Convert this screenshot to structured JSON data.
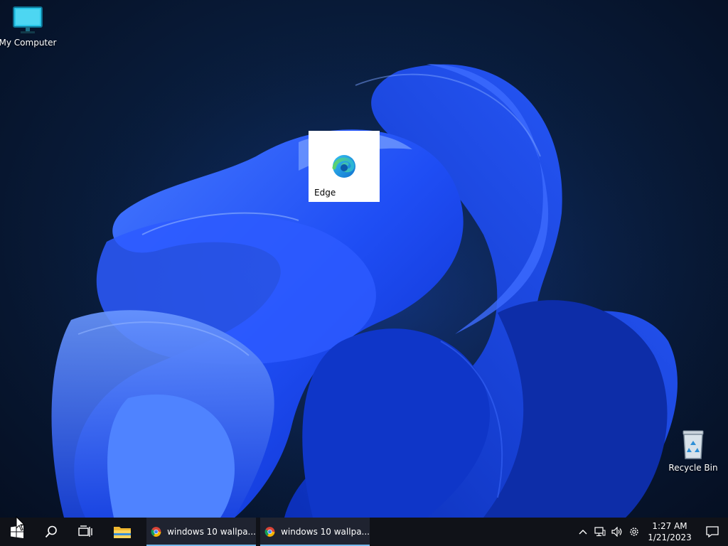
{
  "desktop": {
    "icons": {
      "my_computer": {
        "label": "My Computer",
        "icon": "monitor-icon"
      },
      "edge": {
        "label": "Edge",
        "icon": "edge-icon"
      },
      "recycle_bin": {
        "label": "Recycle Bin",
        "icon": "recycle-bin-icon"
      }
    },
    "wallpaper": {
      "accent": "#1e4fff",
      "background": "#091d3d"
    }
  },
  "taskbar": {
    "start": {
      "icon": "windows-logo-icon"
    },
    "search": {
      "icon": "search-icon"
    },
    "task_view": {
      "icon": "task-view-icon"
    },
    "file_explorer": {
      "icon": "folder-icon"
    },
    "apps": [
      {
        "title": "windows 10 wallpa...",
        "icon": "chrome-icon"
      },
      {
        "title": "windows 10 wallpa...",
        "icon": "chrome-icon"
      }
    ],
    "tray": {
      "icons": [
        "chevron-up-icon",
        "network-icon",
        "volume-icon",
        "settings-gear-icon"
      ],
      "time": "1:27 AM",
      "date": "1/21/2023",
      "notification_icon": "notification-icon"
    }
  }
}
